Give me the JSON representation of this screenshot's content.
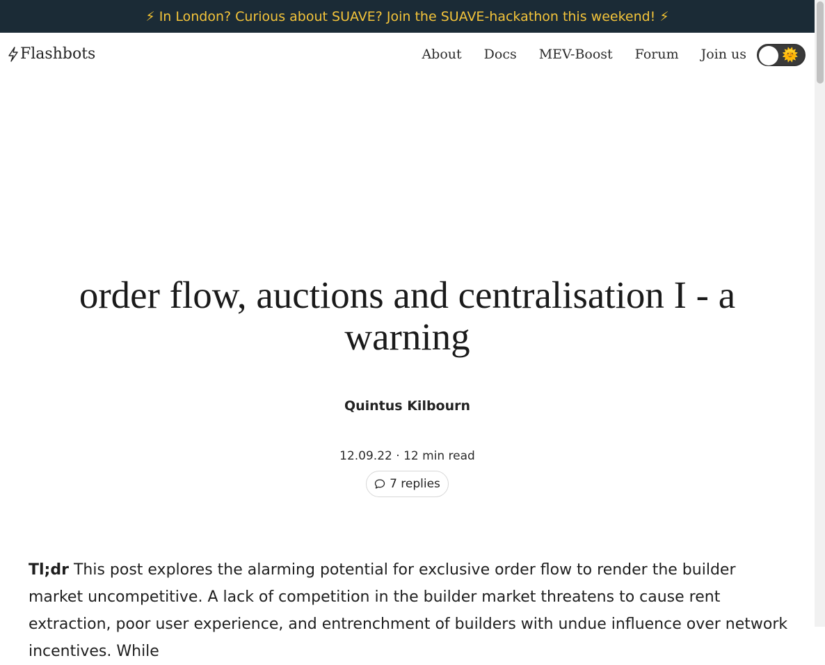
{
  "banner": {
    "text": "In London? Curious about SUAVE? Join the SUAVE-hackathon this weekend!",
    "icon": "lightning-bolt",
    "color": "#f4c43a",
    "background": "#1b2b36"
  },
  "nav": {
    "logo": "Flashbots",
    "links": [
      "About",
      "Docs",
      "MEV-Boost",
      "Forum",
      "Join us"
    ],
    "theme_toggle": {
      "icon": "sun-emoji",
      "state": "light"
    }
  },
  "article": {
    "title": "order flow, auctions and centralisation I - a warning",
    "author": "Quintus Kilbourn",
    "date": "12.09.22",
    "separator": "·",
    "read_time": "12 min read",
    "replies": "7 replies",
    "tldr_label": "Tl;dr",
    "tldr_text": "This post explores the alarming potential for exclusive order flow to render the builder market uncompetitive. A lack of competition in the builder market threatens to cause rent extraction, poor user experience, and entrenchment of builders with undue influence over network incentives. While"
  }
}
